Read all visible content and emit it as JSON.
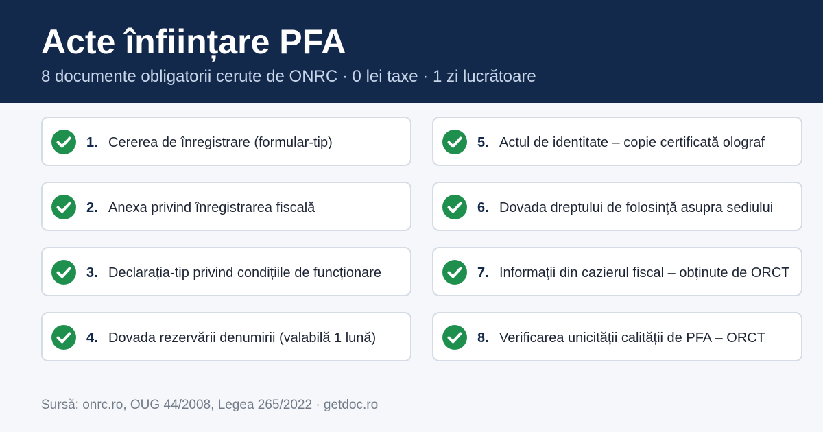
{
  "header": {
    "title": "Acte înființare PFA",
    "subtitle": "8 documente obligatorii cerute de ONRC · 0 lei taxe · 1 zi lucrătoare"
  },
  "colors": {
    "header_bg": "#13294b",
    "check_green": "#1f8f4e",
    "card_border": "#d5dce6",
    "page_bg": "#f5f7fa"
  },
  "items": [
    {
      "number": "1.",
      "label": "Cererea de înregistrare (formular-tip)",
      "icon": "check-circle-icon"
    },
    {
      "number": "2.",
      "label": "Anexa privind înregistrarea fiscală",
      "icon": "check-circle-icon"
    },
    {
      "number": "3.",
      "label": "Declarația-tip privind condițiile de funcționare",
      "icon": "check-circle-icon"
    },
    {
      "number": "4.",
      "label": "Dovada rezervării denumirii (valabilă 1 lună)",
      "icon": "check-circle-icon"
    },
    {
      "number": "5.",
      "label": "Actul de identitate – copie certificată olograf",
      "icon": "check-circle-icon"
    },
    {
      "number": "6.",
      "label": "Dovada dreptului de folosință asupra sediului",
      "icon": "check-circle-icon"
    },
    {
      "number": "7.",
      "label": "Informații din cazierul fiscal – obținute de ORCT",
      "icon": "check-circle-icon"
    },
    {
      "number": "8.",
      "label": "Verificarea unicității calității de PFA – ORCT",
      "icon": "check-circle-icon"
    }
  ],
  "footer": {
    "source": "Sursă: onrc.ro, OUG 44/2008, Legea 265/2022 · getdoc.ro"
  }
}
